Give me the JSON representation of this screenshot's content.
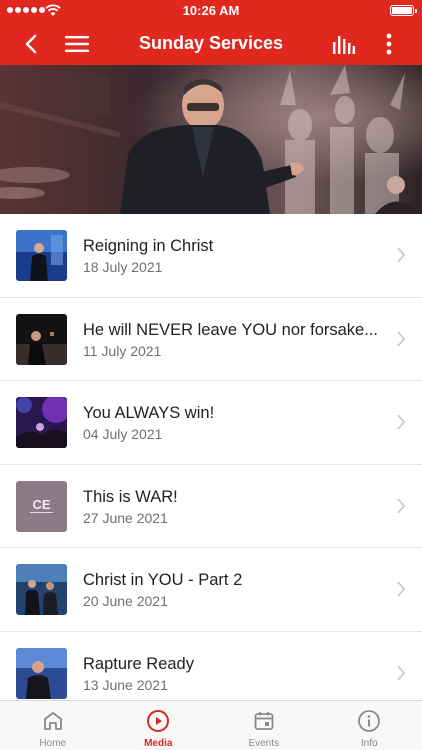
{
  "status_bar": {
    "time": "10:26 AM"
  },
  "nav": {
    "title": "Sunday Services"
  },
  "colors": {
    "brand_red": "#e0281e",
    "active_tab": "#d42a20",
    "date_grey": "#707070"
  },
  "sermons": [
    {
      "title": "Reigning in Christ",
      "date": "18 July 2021",
      "thumb": "preacher-blue-stage"
    },
    {
      "title": "He will NEVER leave YOU nor forsake...",
      "date": "11 July 2021",
      "thumb": "preacher-dark-stage"
    },
    {
      "title": "You ALWAYS win!",
      "date": "04 July 2021",
      "thumb": "worship-purple-lights"
    },
    {
      "title": "This is WAR!",
      "date": "27 June 2021",
      "thumb": "ce-logo"
    },
    {
      "title": "Christ in YOU - Part 2",
      "date": "20 June 2021",
      "thumb": "two-speakers-stage"
    },
    {
      "title": "Rapture Ready",
      "date": "13 June 2021",
      "thumb": "preacher-blue-stage"
    }
  ],
  "tabs": [
    {
      "label": "Home",
      "icon": "home-icon",
      "active": false
    },
    {
      "label": "Media",
      "icon": "play-circle-icon",
      "active": true
    },
    {
      "label": "Events",
      "icon": "calendar-icon",
      "active": false
    },
    {
      "label": "Info",
      "icon": "info-icon",
      "active": false
    }
  ]
}
